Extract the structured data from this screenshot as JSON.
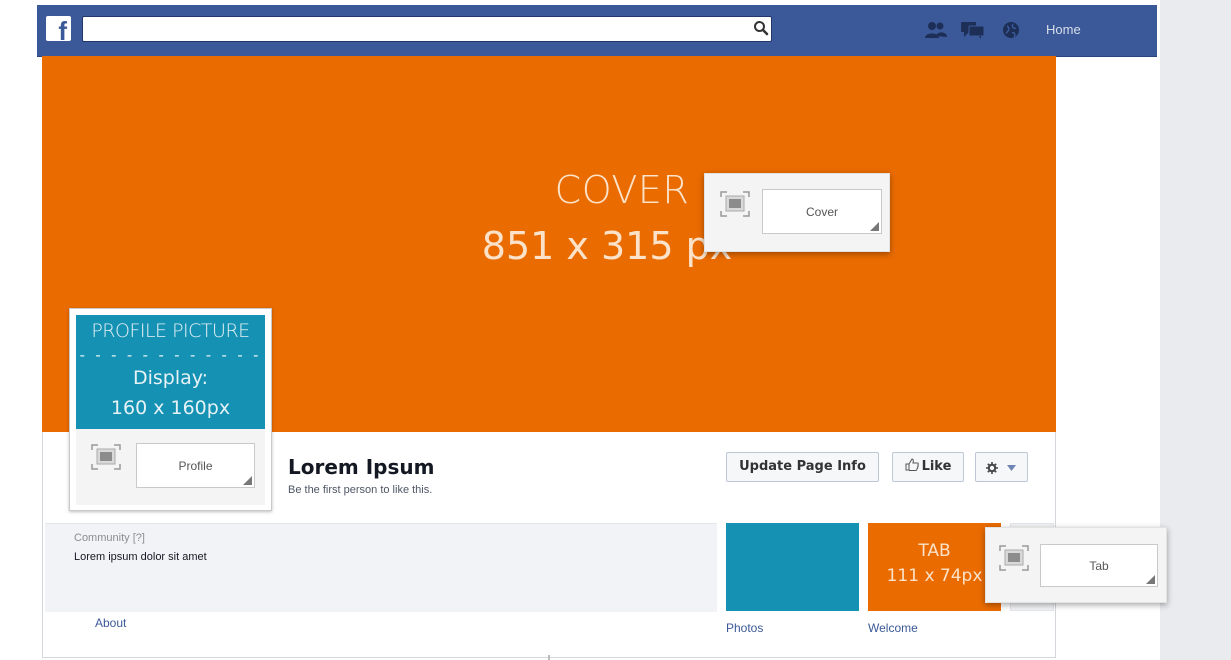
{
  "topbar": {
    "logo": "f",
    "search": {
      "value": "",
      "placeholder": ""
    },
    "nav_home": "Home",
    "icons": [
      "friends-icon",
      "messages-icon",
      "notifications-globe-icon",
      "search-icon"
    ]
  },
  "cover": {
    "title": "COVER",
    "size": "851 x 315 px",
    "upload_label": "Cover"
  },
  "profile": {
    "title": "PROFILE PICTURE",
    "dashes": "- - - - - - - - - - - -",
    "display": "Display:",
    "size": "160 x 160px",
    "upload_label": "Profile"
  },
  "page": {
    "name": "Lorem Ipsum",
    "subtitle": "Be the first person to like this."
  },
  "actions": {
    "update": "Update Page Info",
    "like": "Like"
  },
  "community": {
    "label": "Community",
    "help": "[?]",
    "text": "Lorem ipsum dolor sit amet"
  },
  "about": "About",
  "tabs": {
    "photos": "Photos",
    "welcome": "Welcome",
    "tab_title": "TAB",
    "tab_size": "111 x 74px",
    "upload_label": "Tab"
  },
  "colors": {
    "facebook_blue": "#3b5998",
    "cover_orange": "#ea6b00",
    "profile_teal": "#1591b3"
  }
}
